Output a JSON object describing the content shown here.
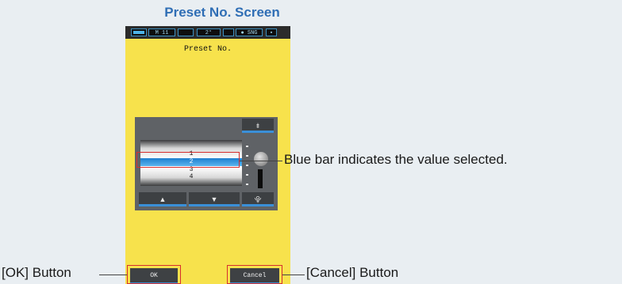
{
  "figure": {
    "title": "Preset No. Screen",
    "annotations": {
      "selection": "Blue bar indicates the value selected.",
      "ok": "[OK] Button",
      "cancel": "[Cancel] Button"
    }
  },
  "device": {
    "status_bar": {
      "mode": "M 11",
      "angle": "2°",
      "sync": "SNG"
    },
    "screen_title": "Preset No.",
    "picker": {
      "items": [
        "1",
        "2",
        "3",
        "4"
      ],
      "selected": "2",
      "scroll_top_glyph": "⯒",
      "scroll_bottom_glyph": "⯓",
      "up_glyph": "▲",
      "down_glyph": "▼"
    },
    "ok_label": "OK",
    "cancel_label": "Cancel"
  },
  "colors": {
    "accent": "#2f6eb5",
    "screen_bg": "#f7e24c",
    "highlight": "#d62e2e",
    "selection": "#1d7fd0"
  }
}
